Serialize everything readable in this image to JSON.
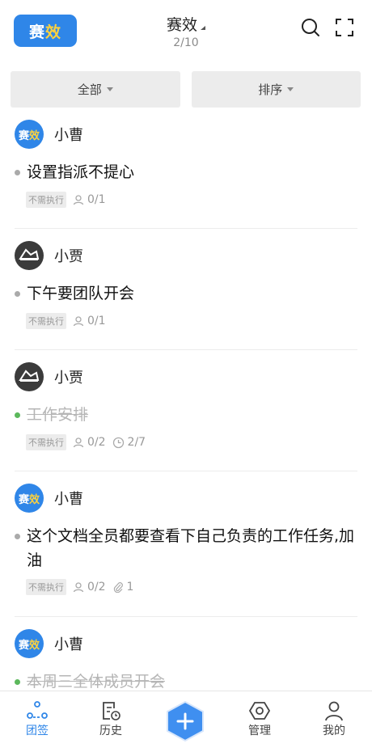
{
  "header": {
    "logo_text_a": "赛",
    "logo_text_b": "效",
    "title": "赛效",
    "subtitle": "2/10"
  },
  "filters": {
    "all": "全部",
    "sort": "排序"
  },
  "tasks": [
    {
      "user": "小曹",
      "avatar": "logo",
      "text": "设置指派不提心",
      "done": false,
      "tag": "不需执行",
      "people": "0/1",
      "time": "",
      "attach": ""
    },
    {
      "user": "小贾",
      "avatar": "face",
      "text": "下午要团队开会",
      "done": false,
      "tag": "不需执行",
      "people": "0/1",
      "time": "",
      "attach": ""
    },
    {
      "user": "小贾",
      "avatar": "face",
      "text": "工作安排",
      "done": true,
      "tag": "不需执行",
      "people": "0/2",
      "time": "2/7",
      "attach": ""
    },
    {
      "user": "小曹",
      "avatar": "logo",
      "text": "这个文档全员都要查看下自己负责的工作任务,加油",
      "done": false,
      "tag": "不需执行",
      "people": "0/2",
      "time": "",
      "attach": "1"
    },
    {
      "user": "小曹",
      "avatar": "logo",
      "text": "本周三全体成员开会",
      "done": true,
      "tag": "",
      "people": "",
      "time": "",
      "attach": ""
    }
  ],
  "tabbar": {
    "tab1": "团签",
    "tab2": "历史",
    "tab3": "管理",
    "tab4": "我的"
  },
  "colors": {
    "accent": "#2f86e8",
    "done": "#5cb85c"
  }
}
